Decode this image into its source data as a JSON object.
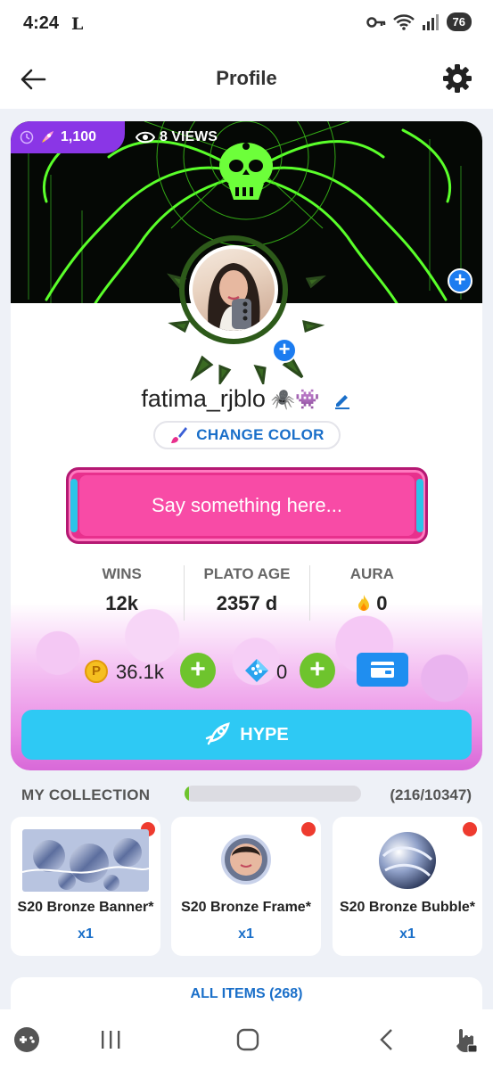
{
  "status_bar": {
    "time": "4:24",
    "carrier_glyph": "L",
    "battery": "76",
    "icons": [
      "key-icon",
      "wifi-icon",
      "signal-icon"
    ]
  },
  "app_bar": {
    "title": "Profile",
    "back_icon": "arrow-left-icon",
    "settings_icon": "gear-icon"
  },
  "banner": {
    "points": "1,100",
    "views": "8 VIEWS"
  },
  "profile": {
    "username": "fatima_rjblo",
    "username_emojis": "🕷️👾",
    "change_color_label": "CHANGE COLOR",
    "say_placeholder": "Say something here..."
  },
  "stats": [
    {
      "label": "WINS",
      "value": "12k"
    },
    {
      "label": "PLATO AGE",
      "value": "2357 d"
    },
    {
      "label": "AURA",
      "value": "0"
    }
  ],
  "currency": {
    "coins": "36.1k",
    "coin_glyph": "P",
    "gems": "0"
  },
  "hype_label": "HYPE",
  "collection": {
    "title": "MY COLLECTION",
    "count": "(216/10347)",
    "progress_fraction": 0.0209,
    "items": [
      {
        "name": "S20 Bronze Banner*",
        "qty": "x1"
      },
      {
        "name": "S20 Bronze Frame*",
        "qty": "x1"
      },
      {
        "name": "S20 Bronze Bubble*",
        "qty": "x1"
      }
    ],
    "all_items_label": "ALL ITEMS (268)"
  },
  "colors": {
    "accent_blue": "#1a6fc9",
    "hype": "#2ec9f4",
    "add_green": "#6ec42d",
    "say_pink": "#f84ba6",
    "points_purple": "#8a36e6",
    "badge_red": "#ee3b2f"
  }
}
